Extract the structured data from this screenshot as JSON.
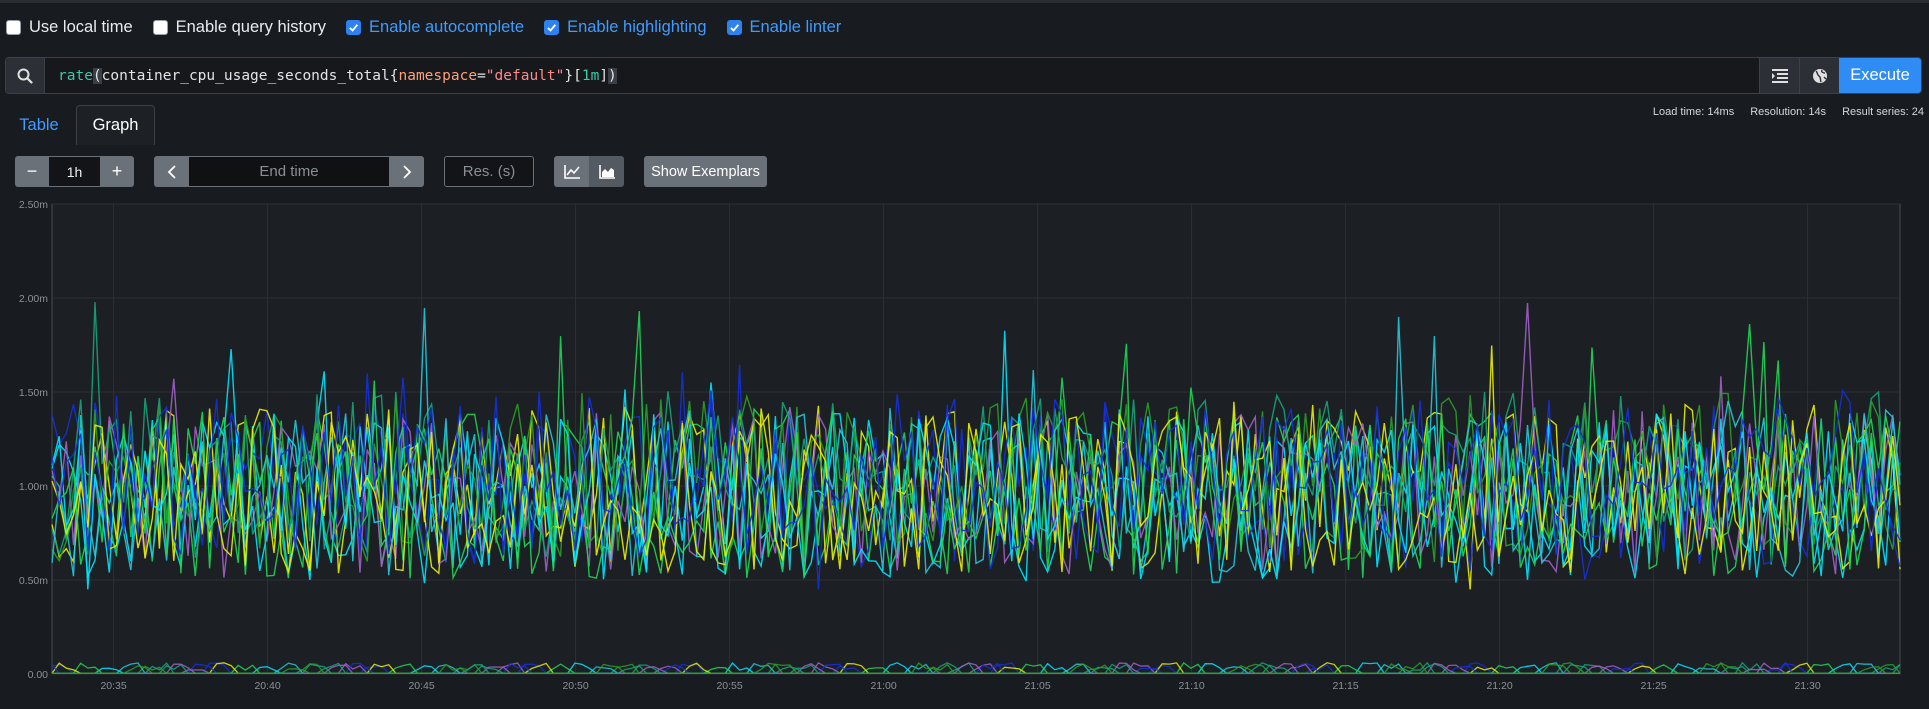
{
  "options": [
    {
      "label": "Use local time",
      "checked": false
    },
    {
      "label": "Enable query history",
      "checked": false
    },
    {
      "label": "Enable autocomplete",
      "checked": true
    },
    {
      "label": "Enable highlighting",
      "checked": true
    },
    {
      "label": "Enable linter",
      "checked": true
    }
  ],
  "query": {
    "fn": "rate",
    "metric": "container_cpu_usage_seconds_total",
    "label_name": "namespace",
    "operator": "=",
    "label_value": "\"default\"",
    "duration": "1m",
    "execute_label": "Execute"
  },
  "tabs": {
    "table": "Table",
    "graph": "Graph"
  },
  "stats": {
    "load_time": "Load time: 14ms",
    "resolution": "Resolution: 14s",
    "result_series": "Result series: 24"
  },
  "controls": {
    "minus": "−",
    "range": "1h",
    "plus": "+",
    "end_time_placeholder": "End time",
    "resolution_placeholder": "Res. (s)",
    "show_exemplars": "Show Exemplars"
  },
  "colors": {
    "accent": "#2f8cf5",
    "link": "#3f9bff",
    "series": [
      "#00e5ff",
      "#1fd655",
      "#e8f000",
      "#1530d8",
      "#a060c8",
      "#16a37a",
      "#2a9d2a",
      "#26c6da"
    ]
  },
  "chart_data": {
    "type": "line",
    "x_range": [
      "20:33",
      "21:33"
    ],
    "ylim": [
      0,
      2.5
    ],
    "y_ticks": [
      {
        "v": 0,
        "label": "0.00"
      },
      {
        "v": 0.5,
        "label": "0.50m"
      },
      {
        "v": 1.0,
        "label": "1.00m"
      },
      {
        "v": 1.5,
        "label": "1.50m"
      },
      {
        "v": 2.0,
        "label": "2.00m"
      },
      {
        "v": 2.5,
        "label": "2.50m"
      }
    ],
    "x_ticks": [
      "20:35",
      "20:40",
      "20:45",
      "20:50",
      "20:55",
      "21:00",
      "21:05",
      "21:10",
      "21:15",
      "21:20",
      "21:25",
      "21:30"
    ],
    "x_tick_minutes": [
      2,
      7,
      12,
      17,
      22,
      27,
      32,
      37,
      42,
      47,
      52,
      57
    ],
    "series_count": 24,
    "grid": true,
    "legend": "none"
  }
}
